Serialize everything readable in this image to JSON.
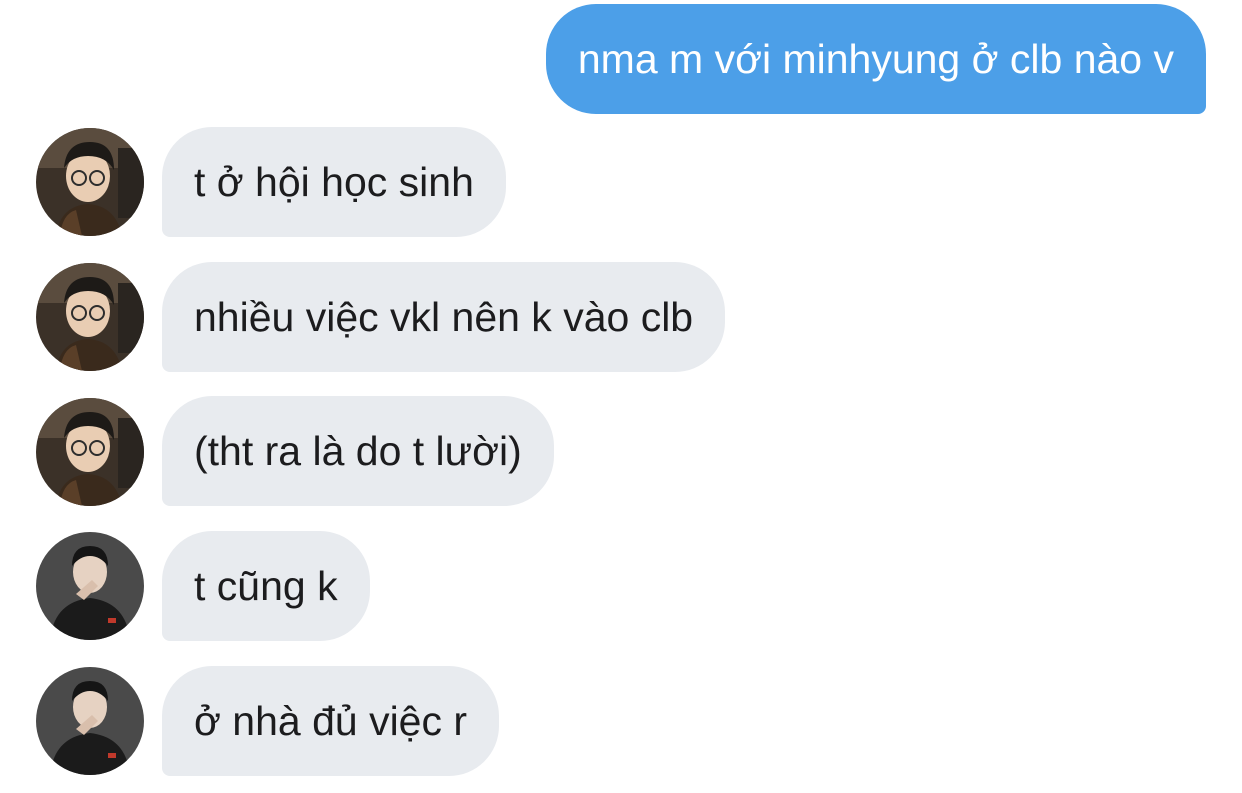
{
  "conversation": {
    "outgoing": [
      {
        "text": "nma m với minhyung ở clb nào v"
      }
    ],
    "incoming": [
      {
        "text": "t ở hội học sinh",
        "sender_avatar": "user-a-avatar"
      },
      {
        "text": "nhiều việc vkl nên k vào clb",
        "sender_avatar": "user-a-avatar"
      },
      {
        "text": "(tht ra là do t lười)",
        "sender_avatar": "user-a-avatar"
      },
      {
        "text": "t cũng k",
        "sender_avatar": "user-b-avatar"
      },
      {
        "text": "ở nhà đủ việc r",
        "sender_avatar": "user-b-avatar"
      }
    ]
  },
  "colors": {
    "outgoing_bubble": "#4c9fe8",
    "incoming_bubble": "#e8ebef",
    "outgoing_text": "#ffffff",
    "incoming_text": "#1c1c1e"
  }
}
